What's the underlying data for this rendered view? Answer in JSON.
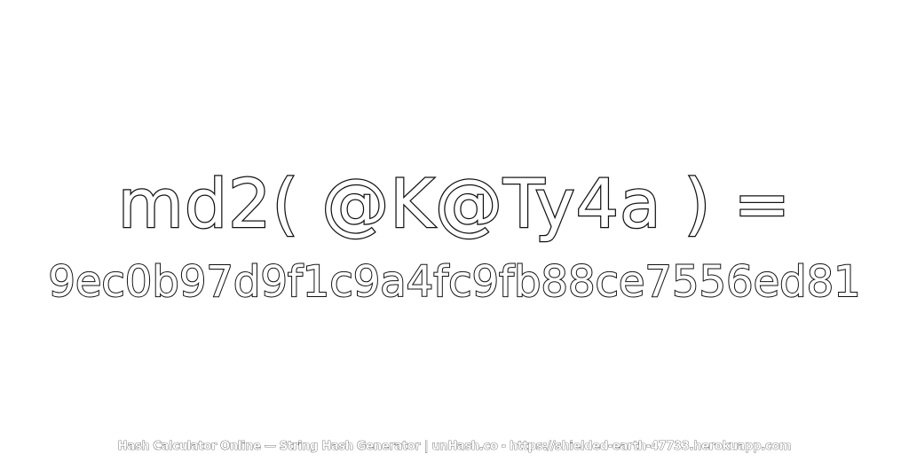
{
  "image": {
    "expression": "md2( @K@Ty4a ) =",
    "hash": "9ec0b97d9f1c9a4fc9fb88ce7556ed81",
    "footer": "Hash Calculator Online — String Hash Generator | unHash.co - https://shielded-earth-47733.herokuapp.com"
  },
  "colors": {
    "background": "#ffffff",
    "text_fill": "#ffffff",
    "text_outline": "#111111"
  }
}
